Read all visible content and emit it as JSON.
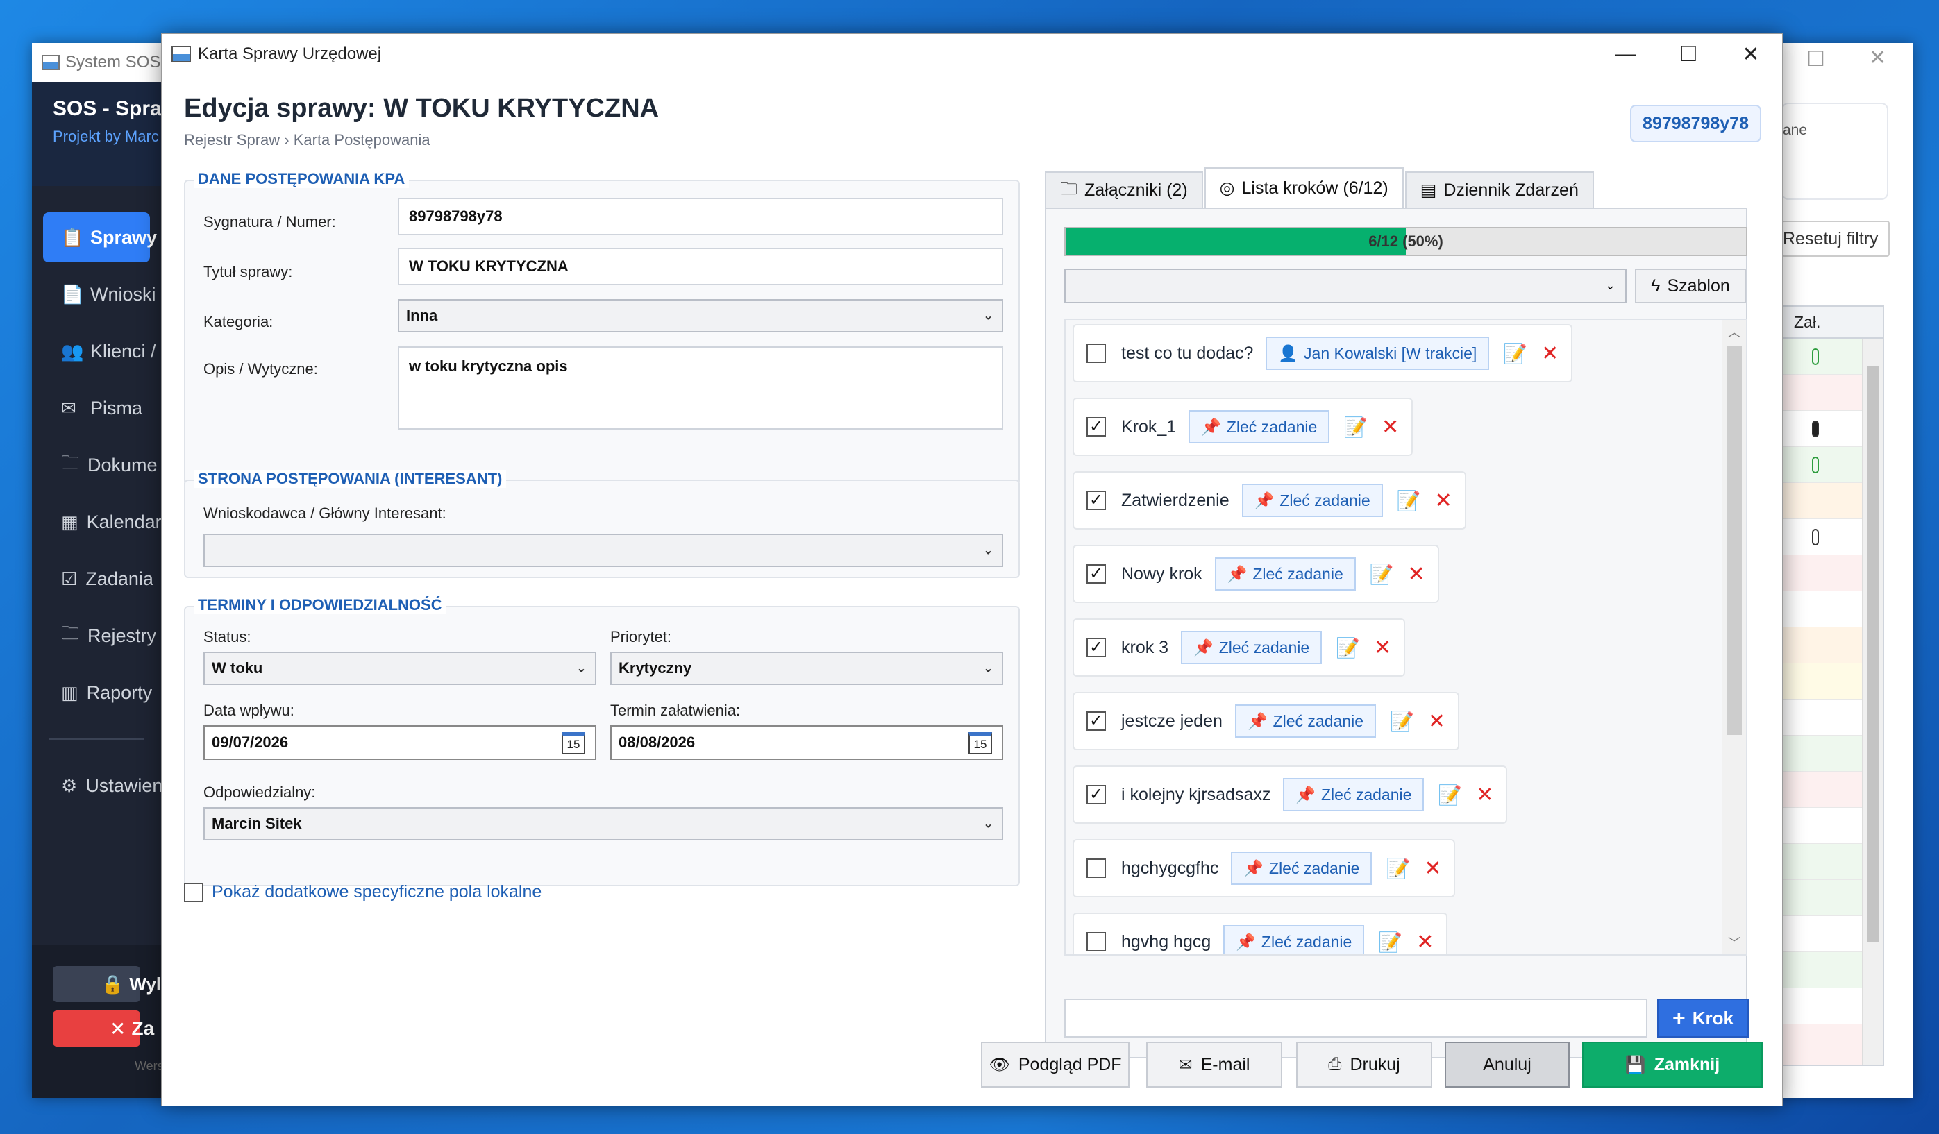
{
  "background_window": {
    "title": "System SOS",
    "brand_title": "SOS - Spraw",
    "brand_subtitle": "Projekt by Marc",
    "nav": [
      {
        "label": "Sprawy",
        "icon": "clipboard-icon",
        "active": true
      },
      {
        "label": "Wnioski",
        "icon": "document-icon"
      },
      {
        "label": "Klienci /",
        "icon": "users-icon"
      },
      {
        "label": "Pisma",
        "icon": "envelope-icon"
      },
      {
        "label": "Dokume",
        "icon": "folder-icon"
      },
      {
        "label": "Kalendar",
        "icon": "calendar-icon"
      },
      {
        "label": "Zadania",
        "icon": "checkbox-icon"
      },
      {
        "label": "Rejestry",
        "icon": "folder-icon"
      },
      {
        "label": "Raporty",
        "icon": "chart-icon"
      },
      {
        "label": "Ustawien",
        "icon": "gear-icon"
      }
    ],
    "logout_label": "Wylo",
    "close_label": "Za",
    "version_label": "Wers",
    "card_text": "ane",
    "reset_filters_label": "Resetuj filtry",
    "table_header": "Zał."
  },
  "dialog": {
    "window_title": "Karta Sprawy Urzędowej",
    "title": "Edycja sprawy: W TOKU KRYTYCZNA",
    "breadcrumb": "Rejestr Spraw › Karta Postępowania",
    "badge": "89798798y78",
    "kpa": {
      "group_title": "DANE POSTĘPOWANIA KPA",
      "sygnatura_label": "Sygnatura / Numer:",
      "sygnatura_value": "89798798y78",
      "tytul_label": "Tytuł sprawy:",
      "tytul_value": "W TOKU KRYTYCZNA",
      "kategoria_label": "Kategoria:",
      "kategoria_value": "Inna",
      "opis_label": "Opis / Wytyczne:",
      "opis_value": "w toku krytyczna opis"
    },
    "strona": {
      "group_title": "STRONA POSTĘPOWANIA (INTERESANT)",
      "wnioskodawca_label": "Wnioskodawca / Główny Interesant:",
      "wnioskodawca_value": ""
    },
    "terminy": {
      "group_title": "TERMINY I ODPOWIEDZIALNOŚĆ",
      "status_label": "Status:",
      "status_value": "W toku",
      "priorytet_label": "Priorytet:",
      "priorytet_value": "Krytyczny",
      "data_wplywu_label": "Data wpływu:",
      "data_wplywu_value": "09/07/2026",
      "termin_label": "Termin załatwienia:",
      "termin_value": "08/08/2026",
      "calendar_day": "15",
      "odpowiedzialny_label": "Odpowiedzialny:",
      "odpowiedzialny_value": "Marcin Sitek"
    },
    "extra_fields_label": "Pokaż dodatkowe specyficzne pola lokalne",
    "tabs": [
      {
        "label": "Załączniki (2)",
        "icon": "folder-icon"
      },
      {
        "label": "Lista kroków (6/12)",
        "icon": "target-icon",
        "active": true
      },
      {
        "label": "Dziennik Zdarzeń",
        "icon": "log-icon"
      }
    ],
    "progress": {
      "text": "6/12 (50%)",
      "fraction": 0.5
    },
    "template_select_value": "",
    "szablon_label": "Szablon",
    "steps": [
      {
        "name": "test co tu dodac?",
        "checked": false,
        "assign_label": "Jan Kowalski [W trakcie]",
        "assign_icon": "user-icon"
      },
      {
        "name": "Krok_1",
        "checked": true,
        "assign_label": "Zleć zadanie",
        "assign_icon": "pin-icon"
      },
      {
        "name": "Zatwierdzenie",
        "checked": true,
        "assign_label": "Zleć zadanie",
        "assign_icon": "pin-icon"
      },
      {
        "name": "Nowy krok",
        "checked": true,
        "assign_label": "Zleć zadanie",
        "assign_icon": "pin-icon"
      },
      {
        "name": "krok 3",
        "checked": true,
        "assign_label": "Zleć zadanie",
        "assign_icon": "pin-icon"
      },
      {
        "name": "jestcze jeden",
        "checked": true,
        "assign_label": "Zleć zadanie",
        "assign_icon": "pin-icon"
      },
      {
        "name": "i kolejny kjrsadsaxz",
        "checked": true,
        "assign_label": "Zleć zadanie",
        "assign_icon": "pin-icon"
      },
      {
        "name": "hgchygcgfhc",
        "checked": false,
        "assign_label": "Zleć zadanie",
        "assign_icon": "pin-icon"
      },
      {
        "name": "hgvhg hgcg",
        "checked": false,
        "assign_label": "Zleć zadanie",
        "assign_icon": "pin-icon"
      }
    ],
    "new_step_value": "",
    "add_step_label": "Krok",
    "footer": {
      "pdf_label": "Podgląd PDF",
      "email_label": "E-mail",
      "print_label": "Drukuj",
      "cancel_label": "Anuluj",
      "close_label": "Zamknij"
    }
  }
}
